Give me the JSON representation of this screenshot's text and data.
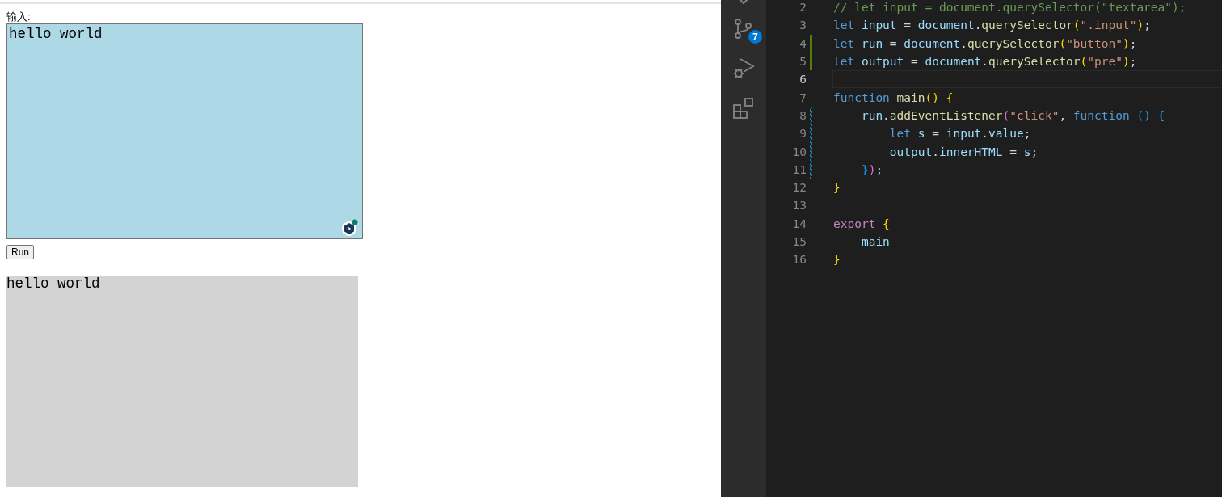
{
  "preview": {
    "input_label": "输入:",
    "input": {
      "value": "hello world"
    },
    "run_button": "Run",
    "output": "hello world"
  },
  "activity_bar": {
    "source_control_badge": "7"
  },
  "editor": {
    "lines": [
      {
        "number": "2",
        "selected": false,
        "kind": "plain",
        "tokens": [
          {
            "text": "// let input = document.querySelector(\"textarea\");",
            "kind": "comment"
          }
        ]
      },
      {
        "number": "3",
        "selected": false,
        "kind": "plain",
        "tokens": [
          {
            "text": "let ",
            "kind": "keyword"
          },
          {
            "text": "input",
            "kind": "variable"
          },
          {
            "text": " = ",
            "kind": "plain"
          },
          {
            "text": "document",
            "kind": "variable"
          },
          {
            "text": ".",
            "kind": "plain"
          },
          {
            "text": "querySelector",
            "kind": "function"
          },
          {
            "text": "(",
            "kind": "bracket1"
          },
          {
            "text": "\".input\"",
            "kind": "string"
          },
          {
            "text": ")",
            "kind": "bracket1"
          },
          {
            "text": ";",
            "kind": "plain"
          }
        ]
      },
      {
        "number": "4",
        "selected": false,
        "kind": "added",
        "tokens": [
          {
            "text": "let ",
            "kind": "keyword"
          },
          {
            "text": "run",
            "kind": "variable"
          },
          {
            "text": " = ",
            "kind": "plain"
          },
          {
            "text": "document",
            "kind": "variable"
          },
          {
            "text": ".",
            "kind": "plain"
          },
          {
            "text": "querySelector",
            "kind": "function"
          },
          {
            "text": "(",
            "kind": "bracket1"
          },
          {
            "text": "\"button\"",
            "kind": "string"
          },
          {
            "text": ")",
            "kind": "bracket1"
          },
          {
            "text": ";",
            "kind": "plain"
          }
        ]
      },
      {
        "number": "5",
        "selected": false,
        "kind": "added",
        "tokens": [
          {
            "text": "let ",
            "kind": "keyword"
          },
          {
            "text": "output",
            "kind": "variable"
          },
          {
            "text": " = ",
            "kind": "plain"
          },
          {
            "text": "document",
            "kind": "variable"
          },
          {
            "text": ".",
            "kind": "plain"
          },
          {
            "text": "querySelector",
            "kind": "function"
          },
          {
            "text": "(",
            "kind": "bracket1"
          },
          {
            "text": "\"pre\"",
            "kind": "string"
          },
          {
            "text": ")",
            "kind": "bracket1"
          },
          {
            "text": ";",
            "kind": "plain"
          }
        ]
      },
      {
        "number": "6",
        "selected": true,
        "kind": "plain"
      },
      {
        "number": "7",
        "selected": false,
        "kind": "plain",
        "tokens": [
          {
            "text": "function ",
            "kind": "keyword"
          },
          {
            "text": "main",
            "kind": "function"
          },
          {
            "text": "() {",
            "kind": "bracket1"
          }
        ]
      },
      {
        "number": "8",
        "selected": false,
        "kind": "modified",
        "tokens": [
          {
            "text": "    run",
            "kind": "variable"
          },
          {
            "text": ".",
            "kind": "plain"
          },
          {
            "text": "addEventListener",
            "kind": "function"
          },
          {
            "text": "(",
            "kind": "bracket2"
          },
          {
            "text": "\"click\"",
            "kind": "string"
          },
          {
            "text": ", ",
            "kind": "plain"
          },
          {
            "text": "function ",
            "kind": "keyword"
          },
          {
            "text": "() {",
            "kind": "bracket3"
          }
        ]
      },
      {
        "number": "9",
        "selected": false,
        "kind": "modified",
        "tokens": [
          {
            "text": "        let ",
            "kind": "keyword"
          },
          {
            "text": "s",
            "kind": "variable"
          },
          {
            "text": " = ",
            "kind": "plain"
          },
          {
            "text": "input",
            "kind": "variable"
          },
          {
            "text": ".",
            "kind": "plain"
          },
          {
            "text": "value",
            "kind": "variable"
          },
          {
            "text": ";",
            "kind": "plain"
          }
        ]
      },
      {
        "number": "10",
        "selected": false,
        "kind": "modified",
        "tokens": [
          {
            "text": "        output",
            "kind": "variable"
          },
          {
            "text": ".",
            "kind": "plain"
          },
          {
            "text": "innerHTML",
            "kind": "variable"
          },
          {
            "text": " = ",
            "kind": "plain"
          },
          {
            "text": "s",
            "kind": "variable"
          },
          {
            "text": ";",
            "kind": "plain"
          }
        ]
      },
      {
        "number": "11",
        "selected": false,
        "kind": "modified",
        "tokens": [
          {
            "text": "    }",
            "kind": "bracket3"
          },
          {
            "text": ")",
            "kind": "bracket2"
          },
          {
            "text": ";",
            "kind": "plain"
          }
        ]
      },
      {
        "number": "12",
        "selected": false,
        "kind": "plain",
        "tokens": [
          {
            "text": "}",
            "kind": "bracket1"
          }
        ]
      },
      {
        "number": "13",
        "selected": false,
        "kind": "plain"
      },
      {
        "number": "14",
        "selected": false,
        "kind": "plain",
        "tokens": [
          {
            "text": "export ",
            "kind": "control"
          },
          {
            "text": "{",
            "kind": "bracket1"
          }
        ]
      },
      {
        "number": "15",
        "selected": false,
        "kind": "plain",
        "tokens": [
          {
            "text": "    main",
            "kind": "variable"
          }
        ]
      },
      {
        "number": "16",
        "selected": false,
        "kind": "plain",
        "tokens": [
          {
            "text": "}",
            "kind": "bracket1"
          }
        ]
      }
    ]
  }
}
